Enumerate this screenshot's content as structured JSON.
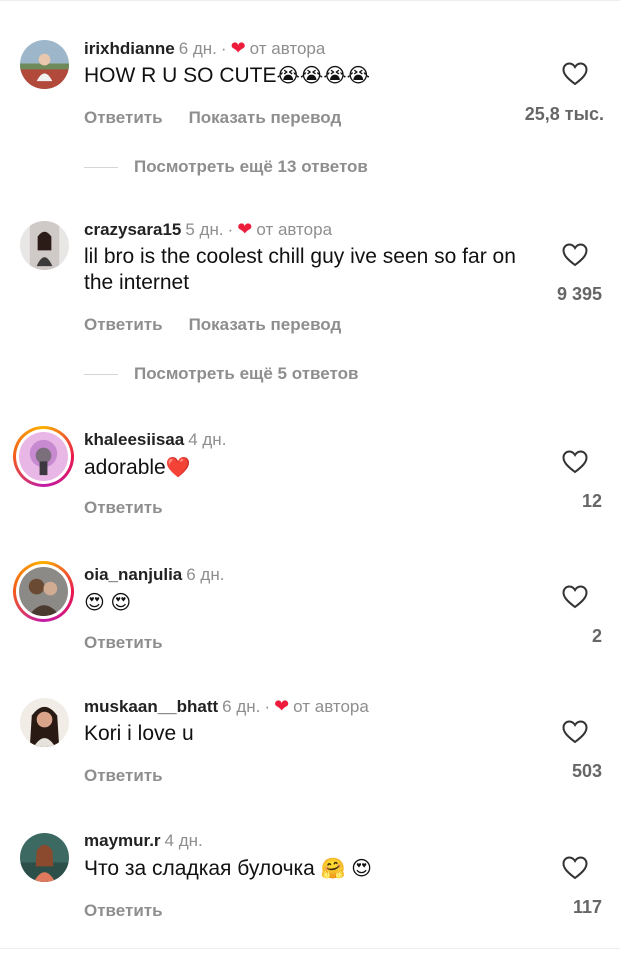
{
  "labels": {
    "reply": "Ответить",
    "translate": "Показать перевод",
    "dot": "·",
    "by_author": "от автора"
  },
  "comments": [
    {
      "username": "irixhdianne",
      "time": "6 дн.",
      "author_liked": true,
      "text": "HOW R U SO CUTE",
      "emoji": "😭😭😭😭",
      "likes": "25,8 тыс.",
      "show_translate": true,
      "more_replies": "Посмотреть ещё 13 ответов"
    },
    {
      "username": "crazysara15",
      "time": "5 дн.",
      "author_liked": true,
      "text": "lil bro is the coolest chill guy ive seen so far on the internet",
      "emoji": "",
      "likes": "9 395",
      "show_translate": true,
      "more_replies": "Посмотреть ещё 5 ответов"
    },
    {
      "username": "khaleesiisaa",
      "time": "4 дн.",
      "author_liked": false,
      "text": "adorable",
      "emoji": "❤️",
      "likes": "12",
      "show_translate": false,
      "more_replies": ""
    },
    {
      "username": "oia_nanjulia",
      "time": "6 дн.",
      "author_liked": false,
      "text": "",
      "emoji": "😍 😍",
      "likes": "2",
      "show_translate": false,
      "more_replies": ""
    },
    {
      "username": "muskaan__bhatt",
      "time": "6 дн.",
      "author_liked": true,
      "text": "Kori i love u",
      "emoji": "",
      "likes": "503",
      "show_translate": false,
      "more_replies": ""
    },
    {
      "username": "maymur.r",
      "time": "4 дн.",
      "author_liked": false,
      "text": "Что за сладкая булочка",
      "emoji": "🤗 😍",
      "likes": "117",
      "show_translate": false,
      "more_replies": ""
    }
  ],
  "colors": {
    "accent_heart": "#ed1c3c",
    "muted": "#8e8e8e",
    "story_ring": "#e8174d"
  }
}
